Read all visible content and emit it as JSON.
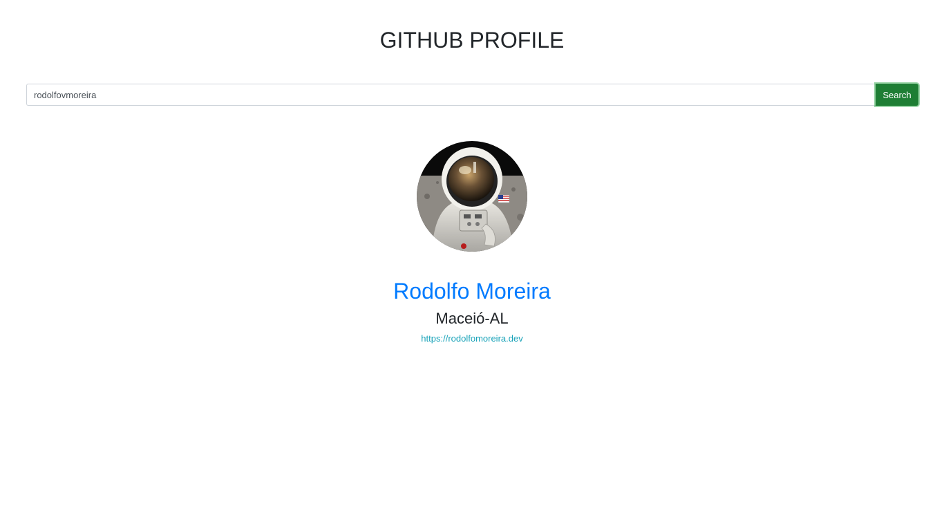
{
  "header": {
    "title": "GITHUB PROFILE"
  },
  "search": {
    "value": "rodolfovmoreira",
    "button_label": "Search"
  },
  "profile": {
    "avatar_icon": "astronaut-avatar",
    "name": "Rodolfo Moreira",
    "location": "Maceió-AL",
    "website": "https://rodolfomoreira.dev"
  },
  "colors": {
    "name_link": "#007bff",
    "website_link": "#17a2b8",
    "search_button": "#1e7e34"
  }
}
